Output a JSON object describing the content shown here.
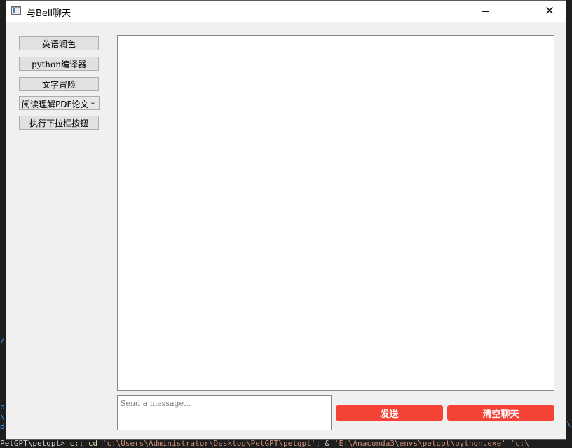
{
  "window": {
    "title": "与Bell聊天"
  },
  "sidebar": {
    "buttons": [
      {
        "label": "英语润色"
      },
      {
        "label": "python编译器"
      },
      {
        "label": "文字冒险"
      }
    ],
    "dropdown": {
      "selected": "阅读理解PDF论文"
    },
    "run_dropdown_label": "执行下拉框按钮"
  },
  "chat": {
    "input_placeholder": "Send a message...",
    "send_label": "发送",
    "clear_label": "清空聊天"
  },
  "background_terminal": {
    "prompt": "PetGPT\\petgpt>",
    "cmd1": "c:;",
    "cmd2": "cd",
    "arg1": "'c:\\Users\\Administrator\\Desktop\\PetGPT\\petgpt';",
    "amp": "&",
    "arg2": "'E:\\Anaconda3\\envs\\petgpt\\python.exe'",
    "arg3": "'c:\\",
    "left_fragments": [
      "/",
      "p",
      "\\",
      "d"
    ],
    "right_fragments": [
      "\\l"
    ]
  },
  "colors": {
    "action_red": "#f44336",
    "window_bg": "#f0f0f0"
  }
}
